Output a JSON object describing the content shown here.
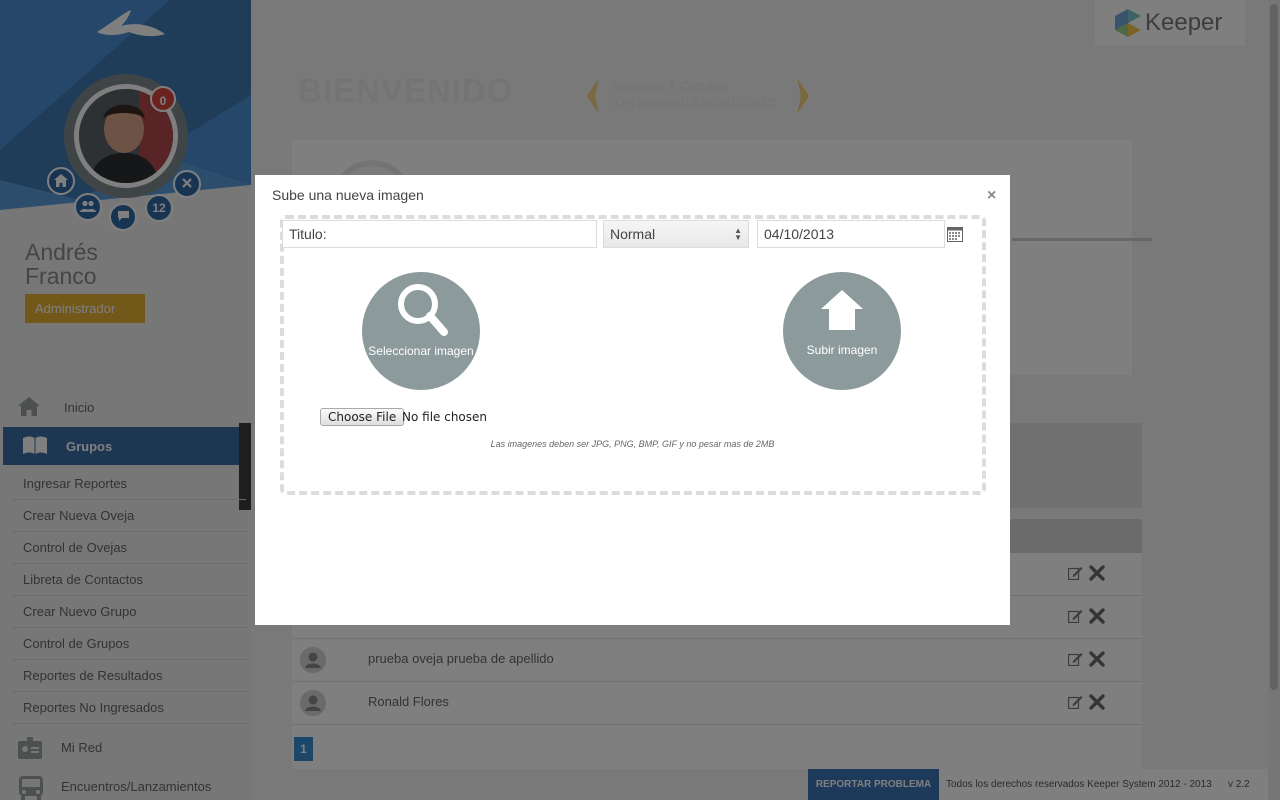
{
  "brand": {
    "name": "Keeper",
    "accent": "#3a6fa6",
    "gold": "#e5b233"
  },
  "user": {
    "first_name": "Andrés",
    "last_name": "Franco",
    "role": "Administrador",
    "notifications": "0",
    "ring_count": "12"
  },
  "nav": {
    "inicio": "Inicio",
    "grupos": "Grupos",
    "subitems": [
      "Ingresar Reportes",
      "Crear Nueva Oveja",
      "Control de Ovejas",
      "Libreta de Contactos",
      "Crear Nuevo Grupo",
      "Control de Grupos",
      "Reportes de Resultados",
      "Reportes No Ingresados"
    ],
    "mi_red": "Mi Red",
    "encuentros": "Encuentros/Lanzamientos"
  },
  "header": {
    "welcome": "BIENVENIDO",
    "week_title": "Semana 1 Octubre",
    "week_range": "(Del 30/09/2013 al 06/10/2013)"
  },
  "people": {
    "rows": [
      "prueba oveja prueba de apellido",
      "Ronald Flores"
    ],
    "page": "1"
  },
  "footer": {
    "report_button": "REPORTAR PROBLEMA",
    "copyright": "Todos los derechos reservados Keeper System 2012 - 2013",
    "version": "v 2.2"
  },
  "modal": {
    "title": "Sube una nueva imagen",
    "close": "×",
    "title_field": "Titulo:",
    "type_select": "Normal",
    "date_field": "04/10/2013",
    "select_label": "Seleccionar imagen",
    "upload_label": "Subir imagen",
    "choose_file": "Choose File",
    "file_status": "No file chosen",
    "hint": "Las imagenes deben ser JPG, PNG, BMP, GIF y no pesar mas de 2MB"
  }
}
